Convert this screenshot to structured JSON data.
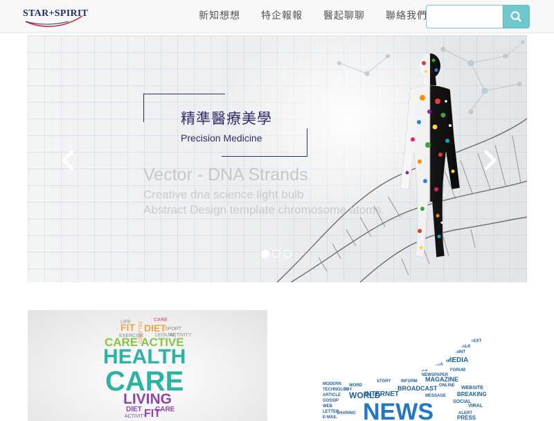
{
  "brand": {
    "logo_text": "STAR+SPIRIT",
    "logo_colors": {
      "text": "#1b2f7a",
      "accent": "#d0282e"
    }
  },
  "nav": {
    "items": [
      {
        "label": "新知想想"
      },
      {
        "label": "特企報報"
      },
      {
        "label": "醫起聊聊"
      },
      {
        "label": "聯絡我們"
      }
    ],
    "search": {
      "value": "",
      "placeholder": "",
      "button_icon": "search-icon"
    }
  },
  "carousel": {
    "caption_zh": "精準醫療美學",
    "caption_en": "Precision Medicine",
    "ghost_title": "Vector - DNA Strands",
    "ghost_lines": [
      "Creative dna science light bulb",
      "Abstract Design template chromosome atoms."
    ],
    "prev_icon": "chevron-left-icon",
    "next_icon": "chevron-right-icon",
    "slide_count": 3,
    "active_slide": 1
  },
  "tiles": {
    "health": {
      "words_small_top": [
        "LIFE",
        "RELAXED",
        "EXERCISE",
        "SPORT",
        "LEISURE",
        "ACTIVITY"
      ],
      "fit": "FIT",
      "diet_top": "DIET",
      "care_small": "CARE",
      "care_active": "CARE ACTIVE",
      "health": "HEALTH",
      "care_big": "CARE",
      "living": "LIVING",
      "diet_bottom": "DIET",
      "fit_bottom": "FIT",
      "care_bottom": "CARE",
      "activity_bottom": "ACTIVITY"
    },
    "news": {
      "big_word": "NEWS",
      "cloud_words": [
        "MEDIA",
        "MAGAZINE",
        "WORLD",
        "INTERNET",
        "BROADCAST",
        "BREAKING",
        "WEBSITE",
        "GOSSIP",
        "VIRAL",
        "SOCIAL",
        "PRESS",
        "ARTICLE",
        "STORY",
        "DATA",
        "TALK",
        "WORD",
        "INFORM",
        "NEWSPAPER",
        "TECHNOLOGY",
        "MODERN",
        "TV",
        "WEB",
        "ALERT",
        "SHARING",
        "E-MAIL",
        "LETTER",
        "PRINT",
        "TEXT",
        "FORUM",
        "BLOG",
        "ONLINE",
        "MESSAGE"
      ]
    }
  }
}
